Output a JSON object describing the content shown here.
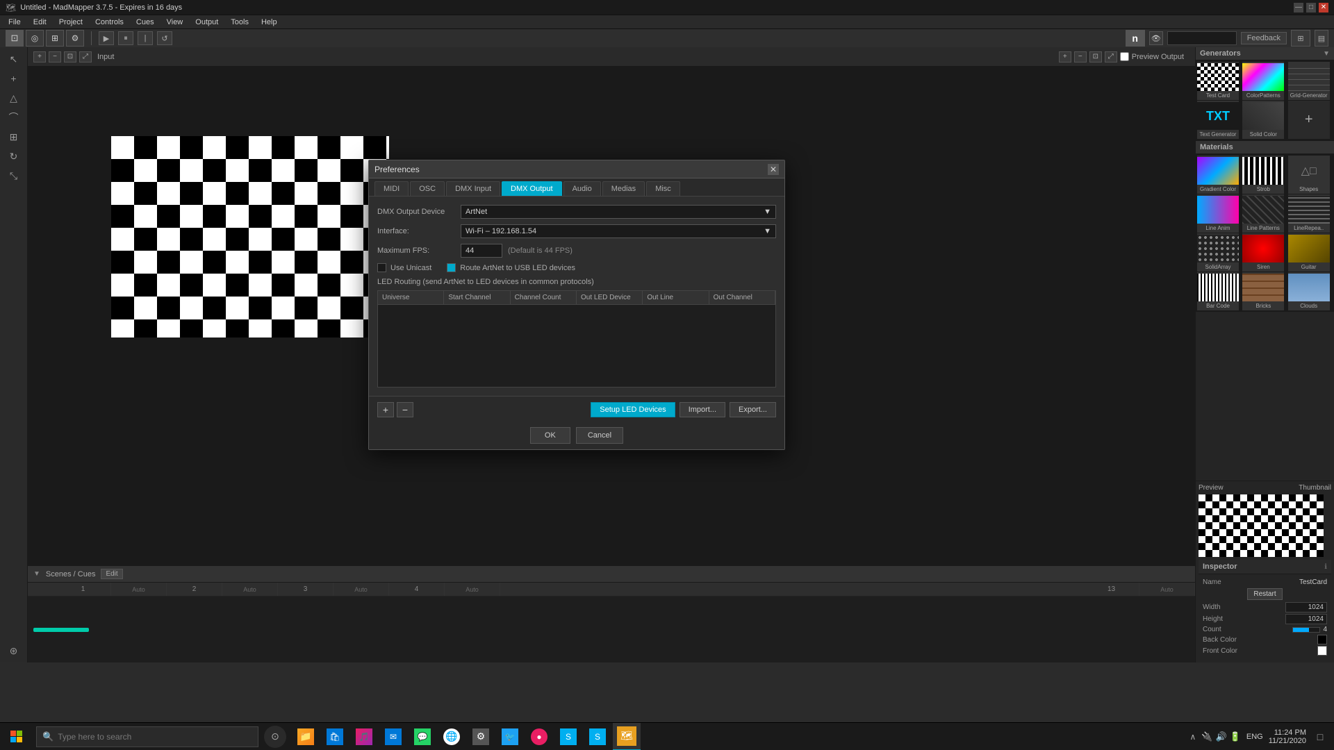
{
  "titlebar": {
    "title": "Untitled - MadMapper 3.7.5 - Expires in 16 days",
    "controls": [
      "—",
      "□",
      "✕"
    ]
  },
  "menubar": {
    "items": [
      "File",
      "Edit",
      "Project",
      "Controls",
      "Cues",
      "View",
      "Output",
      "Tools",
      "Help"
    ]
  },
  "toolbar": {
    "input_label": "Input",
    "preview_output_label": "Preview Output",
    "feedback_label": "Feedback"
  },
  "right_panel": {
    "generators_title": "Generators",
    "generators": [
      {
        "name": "Test Card",
        "style": "gen-checker"
      },
      {
        "name": "ColorPatterns",
        "style": "gen-gradient"
      },
      {
        "name": "Grid-Generator",
        "style": "gen-grid-pattern"
      },
      {
        "name": "Text Generator",
        "style": "gen-txt",
        "text": "TXT"
      },
      {
        "name": "Solid Color",
        "style": "gen-solid"
      }
    ],
    "materials_title": "Materials",
    "materials": [
      {
        "name": "Gradient Color",
        "style": "mat-gradient-color"
      },
      {
        "name": "Strob",
        "style": "mat-strobe"
      },
      {
        "name": "Shapes",
        "style": "mat-shapes"
      },
      {
        "name": "Line Anim",
        "style": "mat-anim"
      },
      {
        "name": "Line Patterns",
        "style": "mat-patterns"
      },
      {
        "name": "LineRepea",
        "style": "mat-line2"
      },
      {
        "name": "SolidArray",
        "style": "mat-dotarray"
      },
      {
        "name": "Siren",
        "style": "mat-siren"
      },
      {
        "name": "Guitar",
        "style": "mat-guitar"
      },
      {
        "name": "Bar Code",
        "style": "mat-barcode"
      },
      {
        "name": "Bricks",
        "style": "mat-bricks"
      },
      {
        "name": "Clouds",
        "style": "mat-clouds"
      }
    ],
    "preview_label": "Preview",
    "thumbnail_label": "Thumbnail",
    "inspector_title": "Inspector",
    "name_label": "Name",
    "name_value": "TestCard",
    "restart_label": "Restart",
    "width_label": "Width",
    "width_value": "1024",
    "height_label": "Height",
    "height_value": "1024",
    "count_label": "Count",
    "count_value": "4",
    "back_color_label": "Back Color",
    "front_color_label": "Front Color"
  },
  "preferences_modal": {
    "title": "Preferences",
    "tabs": [
      "MIDI",
      "OSC",
      "DMX Input",
      "DMX Output",
      "Audio",
      "Medias",
      "Misc"
    ],
    "active_tab": "DMX Output",
    "dmx_output_device_label": "DMX Output Device",
    "dmx_output_device_value": "ArtNet",
    "interface_label": "Interface:",
    "interface_value": "Wi-Fi – 192.168.1.54",
    "max_fps_label": "Maximum FPS:",
    "max_fps_value": "44",
    "max_fps_hint": "(Default is 44 FPS)",
    "use_unicast_label": "Use Unicast",
    "route_artnet_label": "Route ArtNet to USB LED devices",
    "led_routing_label": "LED Routing (send ArtNet to LED devices in common protocols)",
    "table_headers": [
      "Universe",
      "Start Channel",
      "Channel Count",
      "Out LED Device",
      "Out Line",
      "Out Channel"
    ],
    "setup_led_label": "Setup LED Devices",
    "import_label": "Import...",
    "export_label": "Export...",
    "ok_label": "OK",
    "cancel_label": "Cancel"
  },
  "scenes": {
    "title": "Scenes / Cues",
    "edit_label": "Edit",
    "columns": [
      {
        "num": "1",
        "label": "Auto"
      },
      {
        "num": "2",
        "label": "Auto"
      },
      {
        "num": "3",
        "label": "Auto"
      },
      {
        "num": "4",
        "label": "Auto"
      },
      {
        "num": "13",
        "label": "Auto"
      }
    ]
  },
  "taskbar": {
    "search_placeholder": "Type here to search",
    "time": "11:24 PM",
    "date": "11/21/2020",
    "lang": "ENG"
  }
}
